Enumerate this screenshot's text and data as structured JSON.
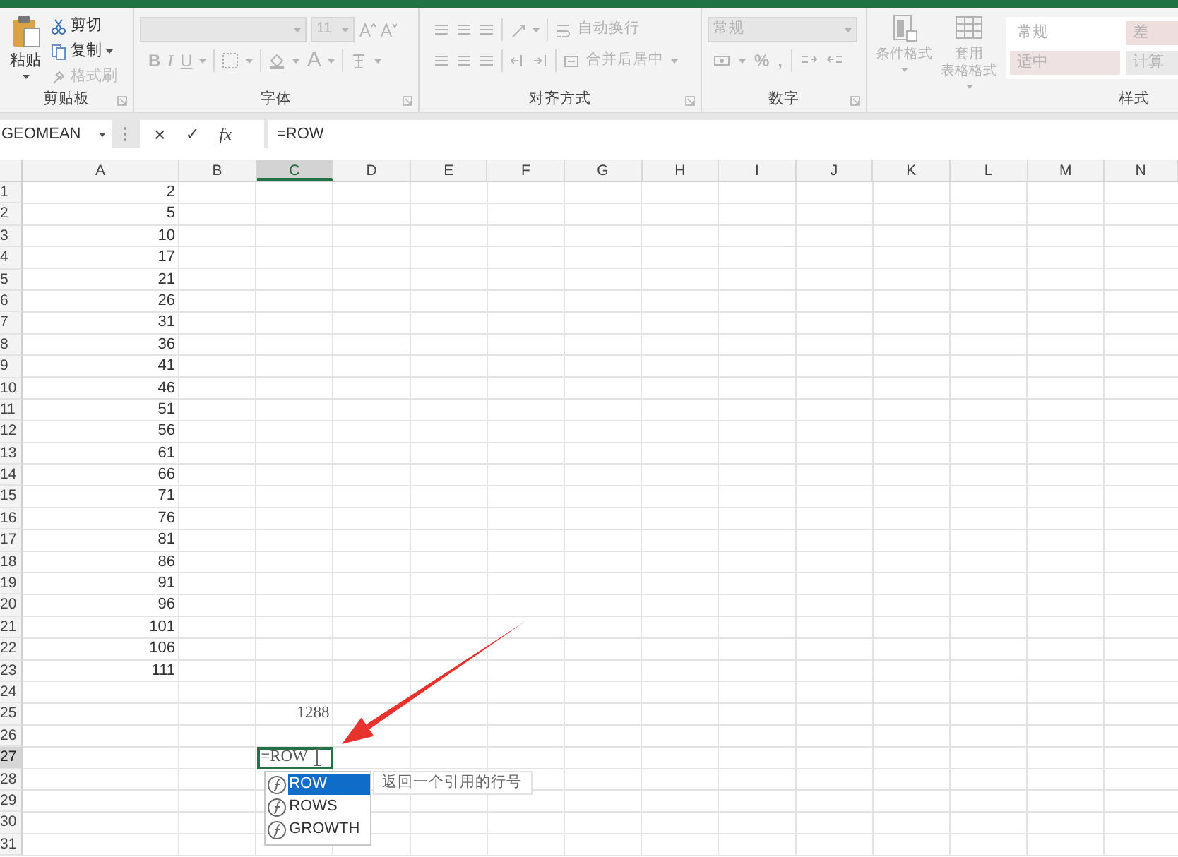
{
  "ribbon": {
    "groups": [
      {
        "kind": "clipboard",
        "label": "剪贴板",
        "paste": {
          "label": "粘贴",
          "disabled": false
        },
        "items": [
          {
            "label": "剪切",
            "disabled": false
          },
          {
            "label": "复制",
            "disabled": false
          },
          {
            "label": "格式刷",
            "disabled": true
          }
        ]
      },
      {
        "kind": "font",
        "label": "字体",
        "disabled": true,
        "font_size": "11",
        "styles": [
          "B",
          "I",
          "U"
        ],
        "color_letter": "A"
      },
      {
        "kind": "alignment",
        "label": "对齐方式",
        "disabled": true,
        "commands": [
          "自动换行",
          "合并后居中"
        ]
      },
      {
        "kind": "number",
        "label": "数字",
        "disabled": true,
        "format": "常规",
        "symbols": [
          "%",
          ","
        ]
      },
      {
        "kind": "styles",
        "label": "样式",
        "disabled": true,
        "commands": [
          [
            "条件格式"
          ],
          [
            "套用",
            "表格格式"
          ]
        ],
        "cell_styles": [
          {
            "label": "常规",
            "color": "#ffffff"
          },
          {
            "label": "差",
            "color": "#efdede"
          },
          {
            "label": "适中",
            "color": "#efe2e2"
          },
          {
            "label": "计算",
            "color": "#e9e9e9"
          }
        ]
      }
    ]
  },
  "formula_bar": {
    "name_box": "GEOMEAN",
    "cancel": "×",
    "enter": "✓",
    "function": "fx",
    "formula": "=ROW"
  },
  "sheet": {
    "columns": [
      {
        "label": "A",
        "selected": false
      },
      {
        "label": "B",
        "selected": false
      },
      {
        "label": "C",
        "selected": true
      },
      {
        "label": "D",
        "selected": false
      },
      {
        "label": "E",
        "selected": false
      },
      {
        "label": "F",
        "selected": false
      },
      {
        "label": "G",
        "selected": false
      },
      {
        "label": "H",
        "selected": false
      },
      {
        "label": "I",
        "selected": false
      },
      {
        "label": "J",
        "selected": false
      },
      {
        "label": "K",
        "selected": false
      },
      {
        "label": "L",
        "selected": false
      },
      {
        "label": "M",
        "selected": false
      },
      {
        "label": "N",
        "selected": false
      }
    ],
    "rows": [
      {
        "label": "1",
        "selected": false,
        "a": "2"
      },
      {
        "label": "2",
        "selected": false,
        "a": "5"
      },
      {
        "label": "3",
        "selected": false,
        "a": "10"
      },
      {
        "label": "4",
        "selected": false,
        "a": "17"
      },
      {
        "label": "5",
        "selected": false,
        "a": "21"
      },
      {
        "label": "6",
        "selected": false,
        "a": "26"
      },
      {
        "label": "7",
        "selected": false,
        "a": "31"
      },
      {
        "label": "8",
        "selected": false,
        "a": "36"
      },
      {
        "label": "9",
        "selected": false,
        "a": "41"
      },
      {
        "label": "10",
        "selected": false,
        "a": "46"
      },
      {
        "label": "11",
        "selected": false,
        "a": "51"
      },
      {
        "label": "12",
        "selected": false,
        "a": "56"
      },
      {
        "label": "13",
        "selected": false,
        "a": "61"
      },
      {
        "label": "14",
        "selected": false,
        "a": "66"
      },
      {
        "label": "15",
        "selected": false,
        "a": "71"
      },
      {
        "label": "16",
        "selected": false,
        "a": "76"
      },
      {
        "label": "17",
        "selected": false,
        "a": "81"
      },
      {
        "label": "18",
        "selected": false,
        "a": "86"
      },
      {
        "label": "19",
        "selected": false,
        "a": "91"
      },
      {
        "label": "20",
        "selected": false,
        "a": "96"
      },
      {
        "label": "21",
        "selected": false,
        "a": "101"
      },
      {
        "label": "22",
        "selected": false,
        "a": "106"
      },
      {
        "label": "23",
        "selected": false,
        "a": "111"
      },
      {
        "label": "24",
        "selected": false
      },
      {
        "label": "25",
        "selected": false,
        "c": "1288"
      },
      {
        "label": "26",
        "selected": false
      },
      {
        "label": "27",
        "selected": true,
        "c": "=ROW"
      },
      {
        "label": "28",
        "selected": false
      },
      {
        "label": "29",
        "selected": false
      },
      {
        "label": "30",
        "selected": false
      },
      {
        "label": "31",
        "selected": false
      }
    ]
  },
  "autocomplete": {
    "items": [
      {
        "label": "ROW",
        "selected": true
      },
      {
        "label": "ROWS",
        "selected": false
      },
      {
        "label": "GROWTH",
        "selected": false
      }
    ],
    "tooltip": "返回一个引用的行号"
  }
}
